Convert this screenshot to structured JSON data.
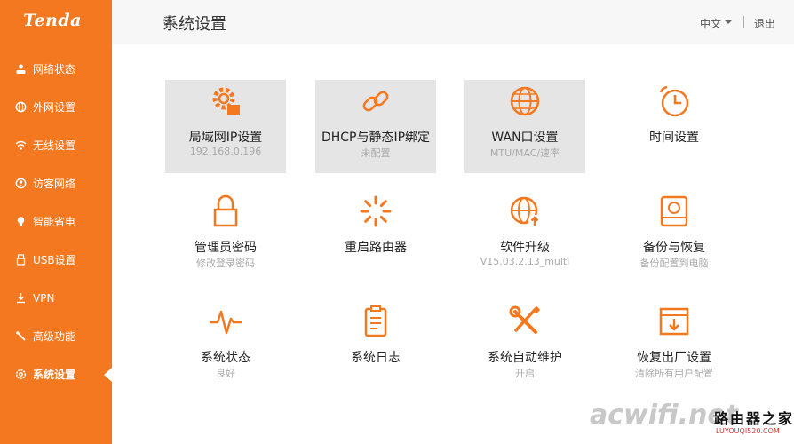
{
  "brand": "Tenda",
  "header": {
    "title": "系统设置",
    "language": "中文",
    "logout": "退出"
  },
  "sidebar": {
    "items": [
      {
        "label": "网络状态",
        "icon": "network-status-icon"
      },
      {
        "label": "外网设置",
        "icon": "globe-icon"
      },
      {
        "label": "无线设置",
        "icon": "wifi-icon"
      },
      {
        "label": "访客网络",
        "icon": "guest-icon"
      },
      {
        "label": "智能省电",
        "icon": "bulb-icon"
      },
      {
        "label": "USB设置",
        "icon": "usb-icon"
      },
      {
        "label": "VPN",
        "icon": "vpn-icon"
      },
      {
        "label": "高级功能",
        "icon": "tools-icon"
      },
      {
        "label": "系统设置",
        "icon": "gear-icon",
        "active": true
      }
    ]
  },
  "tiles": [
    {
      "label": "局域网IP设置",
      "sub": "192.168.0.196",
      "icon": "lan-ip-icon"
    },
    {
      "label": "DHCP与静态IP绑定",
      "sub": "未配置",
      "icon": "link-icon"
    },
    {
      "label": "WAN口设置",
      "sub": "MTU/MAC/速率",
      "icon": "globe-icon"
    },
    {
      "label": "时间设置",
      "sub": "",
      "icon": "clock-icon"
    },
    {
      "label": "管理员密码",
      "sub": "修改登录密码",
      "icon": "lock-icon"
    },
    {
      "label": "重启路由器",
      "sub": "",
      "icon": "spinner-icon"
    },
    {
      "label": "软件升级",
      "sub": "V15.03.2.13_multi",
      "icon": "globe-upgrade-icon"
    },
    {
      "label": "备份与恢复",
      "sub": "备份配置到电脑",
      "icon": "backup-icon"
    },
    {
      "label": "系统状态",
      "sub": "良好",
      "icon": "pulse-icon"
    },
    {
      "label": "系统日志",
      "sub": "",
      "icon": "log-icon"
    },
    {
      "label": "系统自动维护",
      "sub": "开启",
      "icon": "wrench-screwdriver-icon"
    },
    {
      "label": "恢复出厂设置",
      "sub": "清除所有用户配置",
      "icon": "factory-reset-icon"
    }
  ],
  "watermark": {
    "text1": "acwifi.net",
    "text2": "路由器之家",
    "text3": "LUYOUQI520.COM"
  },
  "colors": {
    "accent": "#f4781f",
    "tile_bg": "#e5e5e5"
  }
}
